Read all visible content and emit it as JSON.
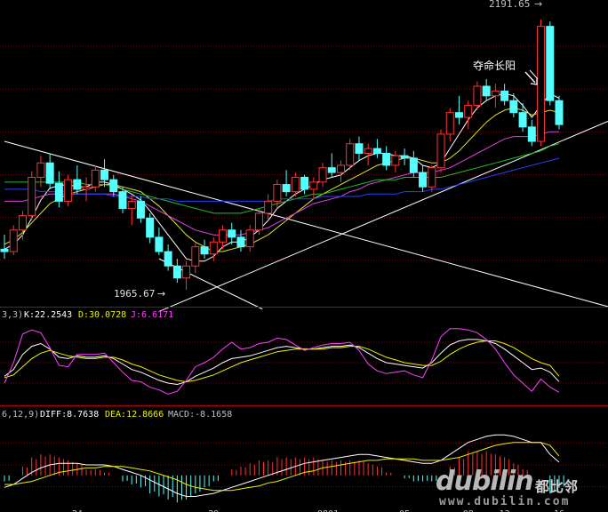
{
  "chart_data": [
    {
      "type": "candlestick",
      "panel": "price",
      "annotations": {
        "high_label": "2191.65",
        "low_label": "1965.67",
        "pattern_label": "夺命长阳"
      },
      "x_tick_labels": [
        "24",
        "29",
        "0801",
        "05",
        "08",
        "13",
        "16"
      ],
      "candles": [
        [
          2000,
          2012,
          1992,
          1998
        ],
        [
          1998,
          2020,
          1995,
          2016
        ],
        [
          2016,
          2032,
          2008,
          2028
        ],
        [
          2028,
          2065,
          2024,
          2060
        ],
        [
          2060,
          2078,
          2052,
          2072
        ],
        [
          2072,
          2080,
          2050,
          2055
        ],
        [
          2055,
          2065,
          2035,
          2040
        ],
        [
          2040,
          2062,
          2036,
          2058
        ],
        [
          2058,
          2070,
          2046,
          2050
        ],
        [
          2050,
          2060,
          2040,
          2052
        ],
        [
          2052,
          2070,
          2048,
          2066
        ],
        [
          2066,
          2075,
          2052,
          2058
        ],
        [
          2058,
          2062,
          2044,
          2048
        ],
        [
          2048,
          2052,
          2030,
          2034
        ],
        [
          2034,
          2045,
          2020,
          2040
        ],
        [
          2040,
          2044,
          2022,
          2026
        ],
        [
          2026,
          2030,
          2005,
          2010
        ],
        [
          2010,
          2018,
          1995,
          1998
        ],
        [
          1998,
          2004,
          1982,
          1986
        ],
        [
          1986,
          1992,
          1972,
          1976
        ],
        [
          1976,
          1990,
          1966,
          1986
        ],
        [
          1986,
          2005,
          1980,
          2002
        ],
        [
          2002,
          2008,
          1992,
          1996
        ],
        [
          1996,
          2010,
          1990,
          2006
        ],
        [
          2006,
          2020,
          2000,
          2016
        ],
        [
          2016,
          2022,
          2004,
          2010
        ],
        [
          2010,
          2016,
          1998,
          2002
        ],
        [
          2002,
          2020,
          1998,
          2016
        ],
        [
          2016,
          2034,
          2012,
          2030
        ],
        [
          2030,
          2046,
          2024,
          2040
        ],
        [
          2040,
          2058,
          2034,
          2054
        ],
        [
          2054,
          2066,
          2044,
          2048
        ],
        [
          2048,
          2064,
          2044,
          2060
        ],
        [
          2060,
          2062,
          2046,
          2050
        ],
        [
          2050,
          2060,
          2042,
          2056
        ],
        [
          2056,
          2072,
          2052,
          2068
        ],
        [
          2068,
          2080,
          2060,
          2064
        ],
        [
          2064,
          2074,
          2056,
          2070
        ],
        [
          2070,
          2092,
          2066,
          2088
        ],
        [
          2088,
          2094,
          2074,
          2080
        ],
        [
          2080,
          2088,
          2070,
          2084
        ],
        [
          2084,
          2092,
          2076,
          2080
        ],
        [
          2080,
          2086,
          2066,
          2070
        ],
        [
          2070,
          2082,
          2064,
          2078
        ],
        [
          2078,
          2084,
          2070,
          2076
        ],
        [
          2076,
          2082,
          2060,
          2064
        ],
        [
          2064,
          2070,
          2048,
          2052
        ],
        [
          2052,
          2070,
          2048,
          2068
        ],
        [
          2068,
          2100,
          2064,
          2096
        ],
        [
          2096,
          2118,
          2090,
          2114
        ],
        [
          2114,
          2128,
          2104,
          2110
        ],
        [
          2110,
          2124,
          2100,
          2120
        ],
        [
          2120,
          2140,
          2116,
          2136
        ],
        [
          2136,
          2142,
          2124,
          2128
        ],
        [
          2128,
          2138,
          2118,
          2132
        ],
        [
          2132,
          2138,
          2120,
          2124
        ],
        [
          2124,
          2130,
          2110,
          2114
        ],
        [
          2114,
          2122,
          2098,
          2102
        ],
        [
          2102,
          2108,
          2086,
          2090
        ],
        [
          2090,
          2191.65,
          2086,
          2186
        ],
        [
          2186,
          2190,
          2120,
          2124
        ],
        [
          2124,
          2128,
          2100,
          2104
        ]
      ],
      "moving_averages": [
        {
          "color": "#ffffff",
          "values": [
            2000,
            2004,
            2012,
            2026,
            2041,
            2051,
            2053,
            2054,
            2052,
            2052,
            2056,
            2056,
            2054,
            2050,
            2046,
            2041,
            2032,
            2022,
            2012,
            2002,
            1992,
            1990,
            1990,
            1994,
            2002,
            2006,
            2006,
            2010,
            2016,
            2024,
            2034,
            2040,
            2046,
            2050,
            2054,
            2058,
            2060,
            2062,
            2068,
            2074,
            2078,
            2080,
            2080,
            2078,
            2078,
            2076,
            2070,
            2068,
            2072,
            2084,
            2096,
            2108,
            2118,
            2124,
            2128,
            2130,
            2128,
            2120,
            2110,
            2120,
            2130,
            2126
          ]
        },
        {
          "color": "#e0e030",
          "values": [
            2004,
            2008,
            2014,
            2022,
            2030,
            2038,
            2042,
            2046,
            2048,
            2050,
            2052,
            2054,
            2054,
            2052,
            2050,
            2048,
            2042,
            2036,
            2028,
            2020,
            2012,
            2006,
            2002,
            1998,
            1998,
            2000,
            2002,
            2004,
            2008,
            2012,
            2018,
            2024,
            2030,
            2036,
            2042,
            2046,
            2050,
            2054,
            2058,
            2062,
            2066,
            2070,
            2072,
            2074,
            2076,
            2076,
            2074,
            2072,
            2072,
            2076,
            2082,
            2090,
            2098,
            2106,
            2112,
            2116,
            2118,
            2116,
            2112,
            2114,
            2116,
            2114
          ]
        },
        {
          "color": "#e040e0",
          "values": [
            2040,
            2040,
            2040,
            2042,
            2044,
            2046,
            2046,
            2046,
            2046,
            2046,
            2046,
            2046,
            2046,
            2044,
            2042,
            2040,
            2036,
            2032,
            2028,
            2024,
            2020,
            2016,
            2014,
            2012,
            2012,
            2012,
            2012,
            2014,
            2016,
            2018,
            2022,
            2026,
            2030,
            2034,
            2038,
            2040,
            2042,
            2044,
            2048,
            2050,
            2054,
            2056,
            2058,
            2060,
            2062,
            2064,
            2064,
            2064,
            2066,
            2068,
            2072,
            2076,
            2080,
            2084,
            2088,
            2092,
            2094,
            2094,
            2094,
            2096,
            2098,
            2098
          ]
        },
        {
          "color": "#20c020",
          "values": [
            2056,
            2056,
            2056,
            2056,
            2056,
            2056,
            2056,
            2056,
            2056,
            2054,
            2054,
            2054,
            2052,
            2050,
            2048,
            2046,
            2044,
            2042,
            2040,
            2038,
            2036,
            2034,
            2032,
            2030,
            2030,
            2030,
            2030,
            2032,
            2034,
            2036,
            2038,
            2040,
            2042,
            2044,
            2046,
            2046,
            2048,
            2050,
            2052,
            2054,
            2056,
            2058,
            2058,
            2058,
            2060,
            2060,
            2060,
            2060,
            2060,
            2062,
            2064,
            2066,
            2068,
            2070,
            2072,
            2074,
            2076,
            2078,
            2080,
            2082,
            2086,
            2088
          ]
        },
        {
          "color": "#2840ff",
          "values": [
            2050,
            2050,
            2050,
            2050,
            2048,
            2048,
            2048,
            2048,
            2046,
            2046,
            2046,
            2046,
            2044,
            2044,
            2044,
            2044,
            2042,
            2042,
            2042,
            2040,
            2040,
            2040,
            2040,
            2040,
            2040,
            2040,
            2040,
            2040,
            2040,
            2040,
            2042,
            2042,
            2042,
            2042,
            2042,
            2044,
            2044,
            2044,
            2044,
            2044,
            2046,
            2046,
            2046,
            2046,
            2048,
            2048,
            2048,
            2050,
            2050,
            2052,
            2054,
            2056,
            2058,
            2060,
            2062,
            2064,
            2066,
            2068,
            2070,
            2072,
            2074,
            2076
          ]
        }
      ],
      "trend_lines": [
        {
          "color": "#ffffff",
          "from": [
            0,
            2090
          ],
          "to": [
            62,
            1950
          ]
        },
        {
          "color": "#ffffff",
          "from": [
            17,
            1948
          ],
          "to": [
            62,
            2110
          ]
        },
        {
          "color": "#ffffff",
          "from": [
            17,
            1992
          ],
          "to": [
            23,
            1950
          ]
        }
      ],
      "ylim": [
        1955,
        2205
      ],
      "grid": true
    },
    {
      "type": "line",
      "panel": "KDJ",
      "header_prefix": "3,3)",
      "legend": [
        {
          "label": "K:22.2543",
          "color": "#ffffff"
        },
        {
          "label": "D:30.0728",
          "color": "#f0f000"
        },
        {
          "label": "J:6.6171",
          "color": "#ff40ff"
        }
      ],
      "ylim": [
        -10,
        110
      ],
      "series": [
        {
          "color": "#ffffff",
          "values": [
            30,
            40,
            62,
            74,
            78,
            70,
            58,
            56,
            60,
            58,
            58,
            60,
            56,
            48,
            40,
            36,
            30,
            24,
            20,
            18,
            22,
            30,
            36,
            42,
            50,
            56,
            58,
            60,
            64,
            68,
            72,
            74,
            72,
            70,
            70,
            72,
            74,
            74,
            76,
            72,
            64,
            56,
            50,
            48,
            46,
            44,
            42,
            50,
            64,
            76,
            82,
            84,
            84,
            82,
            78,
            70,
            60,
            50,
            40,
            42,
            36,
            22.25
          ]
        },
        {
          "color": "#f0f000",
          "values": [
            28,
            32,
            44,
            56,
            64,
            68,
            64,
            60,
            58,
            56,
            56,
            58,
            58,
            54,
            48,
            44,
            38,
            32,
            28,
            24,
            22,
            24,
            28,
            32,
            38,
            44,
            50,
            54,
            58,
            62,
            66,
            68,
            70,
            70,
            70,
            70,
            72,
            72,
            74,
            74,
            70,
            64,
            58,
            54,
            50,
            48,
            46,
            46,
            52,
            62,
            70,
            76,
            80,
            82,
            82,
            78,
            72,
            64,
            56,
            50,
            46,
            30.07
          ]
        },
        {
          "color": "#ff40ff",
          "values": [
            20,
            50,
            92,
            98,
            94,
            72,
            46,
            44,
            62,
            62,
            62,
            64,
            50,
            36,
            24,
            22,
            14,
            10,
            4,
            8,
            24,
            44,
            50,
            58,
            70,
            80,
            70,
            72,
            78,
            80,
            86,
            84,
            76,
            68,
            72,
            76,
            78,
            78,
            80,
            68,
            48,
            38,
            34,
            36,
            38,
            32,
            28,
            54,
            88,
            100,
            100,
            98,
            94,
            84,
            70,
            50,
            32,
            20,
            8,
            26,
            14,
            6.62
          ]
        }
      ]
    },
    {
      "type": "bar+line",
      "panel": "MACD",
      "header_prefix": "6,12,9)",
      "legend": [
        {
          "label": "DIFF:8.7638",
          "color": "#ffffff"
        },
        {
          "label": "DEA:12.8666",
          "color": "#f0f000"
        },
        {
          "label": "MACD:-8.1658",
          "color": "#c0c0c0"
        }
      ],
      "ylim": [
        -22,
        36
      ],
      "diff": [
        -8,
        -6,
        -2,
        2,
        5,
        7,
        8,
        8,
        8,
        7,
        7,
        7,
        6,
        4,
        2,
        0,
        -3,
        -6,
        -9,
        -12,
        -14,
        -14,
        -13,
        -12,
        -10,
        -8,
        -6,
        -4,
        -2,
        0,
        2,
        4,
        6,
        8,
        9,
        10,
        11,
        12,
        13,
        14,
        14,
        13,
        12,
        11,
        10,
        9,
        8,
        8,
        10,
        14,
        18,
        22,
        24,
        26,
        27,
        27,
        26,
        24,
        22,
        22,
        14,
        8.76
      ],
      "dea": [
        -6,
        -6,
        -5,
        -4,
        -2,
        0,
        2,
        3,
        4,
        5,
        5,
        6,
        6,
        6,
        5,
        4,
        3,
        1,
        -1,
        -3,
        -6,
        -8,
        -9,
        -10,
        -10,
        -10,
        -9,
        -8,
        -7,
        -5,
        -4,
        -2,
        0,
        2,
        3,
        5,
        6,
        7,
        8,
        9,
        10,
        10,
        11,
        11,
        11,
        11,
        10,
        10,
        10,
        11,
        12,
        14,
        16,
        18,
        20,
        21,
        22,
        22,
        22,
        22,
        20,
        12.87
      ]
    }
  ]
}
